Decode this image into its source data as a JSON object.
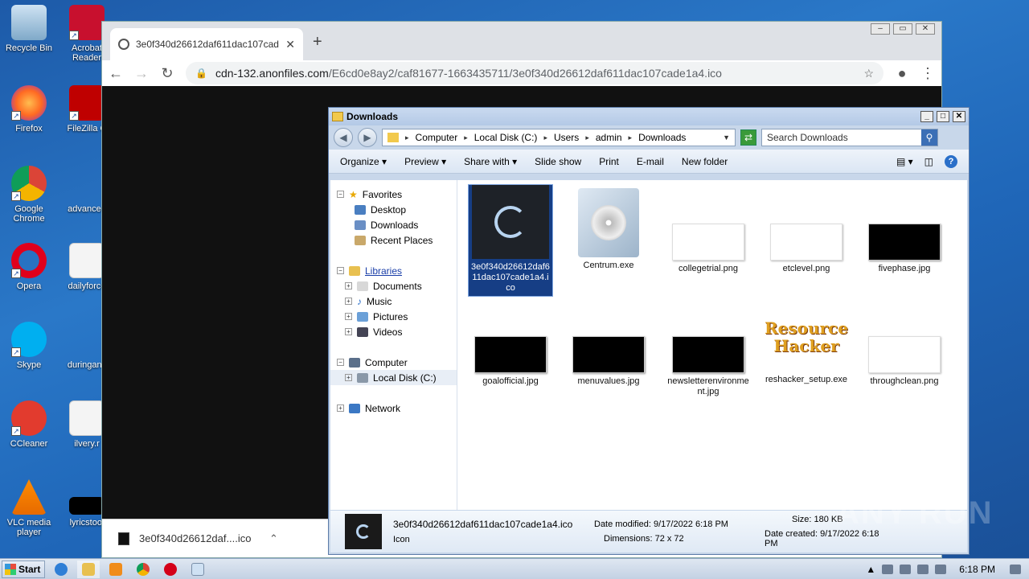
{
  "desktop": {
    "icons": [
      {
        "label": "Recycle Bin"
      },
      {
        "label": "Acrobat Reader"
      },
      {
        "label": "Firefox"
      },
      {
        "label": "FileZilla C"
      },
      {
        "label": "Google Chrome"
      },
      {
        "label": "advanced"
      },
      {
        "label": "Opera"
      },
      {
        "label": "dailyforce"
      },
      {
        "label": "Skype"
      },
      {
        "label": "duringany"
      },
      {
        "label": "CCleaner"
      },
      {
        "label": "ilvery.r"
      },
      {
        "label": "VLC media player"
      },
      {
        "label": "lyricstool"
      }
    ]
  },
  "chrome": {
    "tab_title": "3e0f340d26612daf611dac107cade",
    "url_host": "cdn-132.anonfiles.com",
    "url_path": "/E6cd0e8ay2/caf81677-1663435711/3e0f340d26612daf611dac107cade1a4.ico",
    "download_name": "3e0f340d26612daf....ico"
  },
  "explorer": {
    "title": "Downloads",
    "breadcrumb": [
      "Computer",
      "Local Disk (C:)",
      "Users",
      "admin",
      "Downloads"
    ],
    "search_placeholder": "Search Downloads",
    "commands": [
      "Organize",
      "Preview",
      "Share with",
      "Slide show",
      "Print",
      "E-mail",
      "New folder"
    ],
    "nav": {
      "favorites": "Favorites",
      "desktop": "Desktop",
      "downloads": "Downloads",
      "recent": "Recent Places",
      "libraries": "Libraries",
      "documents": "Documents",
      "music": "Music",
      "pictures": "Pictures",
      "videos": "Videos",
      "computer": "Computer",
      "localdisk": "Local Disk (C:)",
      "network": "Network"
    },
    "files": [
      {
        "name": "3e0f340d26612daf611dac107cade1a4.ico"
      },
      {
        "name": "Centrum.exe"
      },
      {
        "name": "collegetrial.png"
      },
      {
        "name": "etclevel.png"
      },
      {
        "name": "fivephase.jpg"
      },
      {
        "name": "goalofficial.jpg"
      },
      {
        "name": "menuvalues.jpg"
      },
      {
        "name": "newsletterenvironment.jpg"
      },
      {
        "name": "reshacker_setup.exe"
      },
      {
        "name": "throughclean.png"
      }
    ],
    "details": {
      "name": "3e0f340d26612daf611dac107cade1a4.ico",
      "type": "Icon",
      "modified": "Date modified: 9/17/2022 6:18 PM",
      "dimensions": "Dimensions: 72 x 72",
      "size": "Size: 180 KB",
      "created": "Date created: 9/17/2022 6:18 PM"
    }
  },
  "taskbar": {
    "start": "Start",
    "clock": "6:18 PM"
  },
  "watermark": "ANY RUN"
}
